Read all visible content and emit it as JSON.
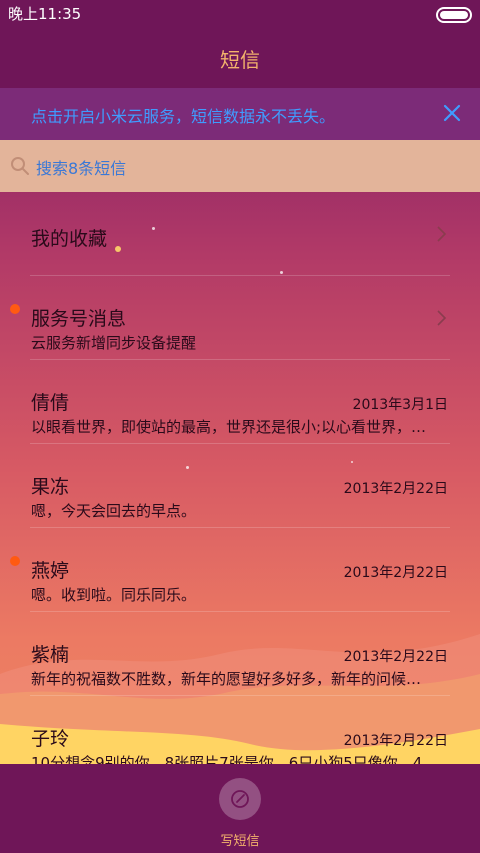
{
  "status": {
    "time": "晚上11:35"
  },
  "header": {
    "title": "短信"
  },
  "notice": {
    "text": "点击开启小米云服务，短信数据永不丢失。"
  },
  "search": {
    "text": "搜索8条短信"
  },
  "list": [
    {
      "name": "我的收藏",
      "preview": "",
      "date": "",
      "unread": false,
      "chevron": true
    },
    {
      "name": "服务号消息",
      "preview": "云服务新增同步设备提醒",
      "date": "",
      "unread": true,
      "chevron": true
    },
    {
      "name": "倩倩",
      "preview": "以眼看世界，即使站的最高，世界还是很小;以心看世界，…",
      "date": "2013年3月1日",
      "unread": false
    },
    {
      "name": "果冻",
      "preview": "嗯，今天会回去的早点。",
      "date": "2013年2月22日",
      "unread": false
    },
    {
      "name": "燕婷",
      "preview": "嗯。收到啦。同乐同乐。",
      "date": "2013年2月22日",
      "unread": true
    },
    {
      "name": "紫楠",
      "preview": "新年的祝福数不胜数，新年的愿望好多好多，新年的问候…",
      "date": "2013年2月22日",
      "unread": false
    },
    {
      "name": "子玲",
      "preview": "10分想念9别的你，8张照片7张是你，6只小狗5只像你，4…",
      "date": "2013年2月22日",
      "unread": false
    }
  ],
  "bottom": {
    "compose_label": "写短信"
  },
  "colors": {
    "accent": "#f3b36c",
    "link": "#3f9cff",
    "unread_dot": "#ff5a12"
  }
}
